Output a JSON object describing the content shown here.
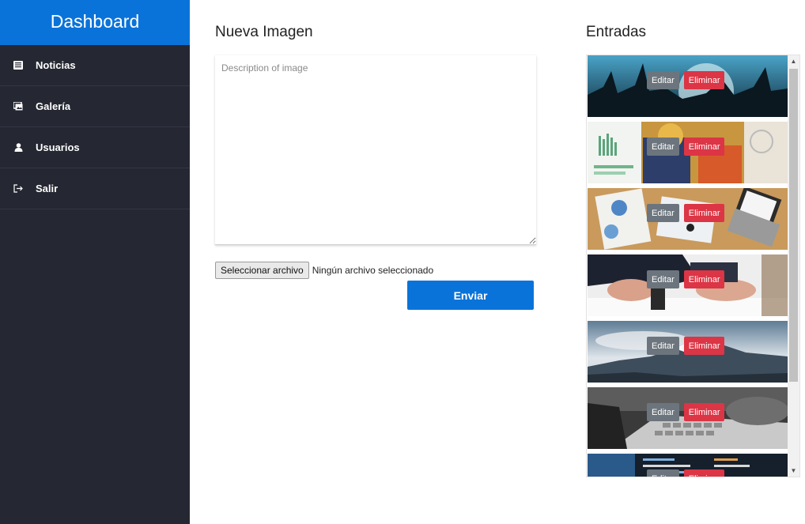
{
  "sidebar": {
    "brand": "Dashboard",
    "items": [
      {
        "label": "Noticias",
        "icon": "newspaper-icon"
      },
      {
        "label": "Galería",
        "icon": "gallery-icon"
      },
      {
        "label": "Usuarios",
        "icon": "user-icon"
      },
      {
        "label": "Salir",
        "icon": "logout-icon"
      }
    ]
  },
  "form": {
    "title": "Nueva Imagen",
    "description_placeholder": "Description of image",
    "file_button": "Seleccionar archivo",
    "file_status": "Ningún archivo seleccionado",
    "submit": "Enviar"
  },
  "entries": {
    "title": "Entradas",
    "edit_label": "Editar",
    "delete_label": "Eliminar",
    "items": [
      {
        "image": "concert-crowd"
      },
      {
        "image": "office-charts-team"
      },
      {
        "image": "desk-laptop-documents"
      },
      {
        "image": "businessman-stamp"
      },
      {
        "image": "mountain-landscape"
      },
      {
        "image": "keyboard-typing"
      },
      {
        "image": "code-screen"
      }
    ]
  },
  "colors": {
    "accent": "#0a73d9",
    "sidebar_bg": "#252732",
    "edit": "#6c757d",
    "delete": "#dc3545"
  }
}
